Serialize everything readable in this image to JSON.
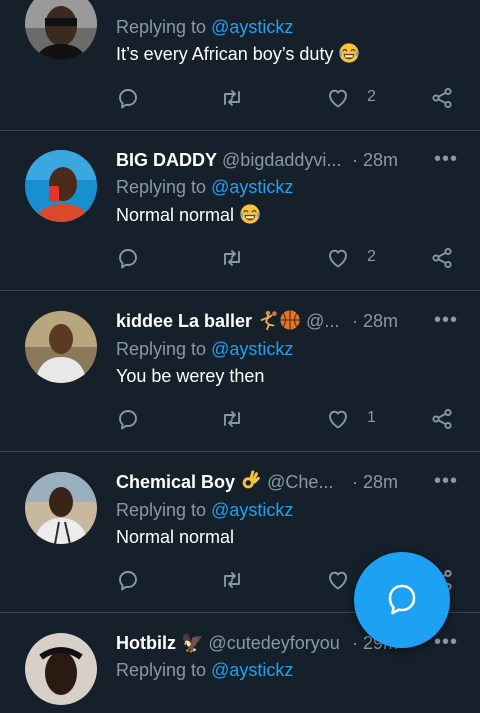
{
  "tweets": [
    {
      "name": "",
      "handle": "",
      "time": "",
      "replying_prefix": "Replying to ",
      "replying_to": "@aystickz",
      "text": "It’s every African boy’s duty",
      "text_emoji": "tears-of-joy-emoji",
      "likes": "2"
    },
    {
      "name": "BIG DADDY",
      "handle": "@bigdaddyvi...",
      "time": "· 28m",
      "replying_prefix": "Replying to ",
      "replying_to": "@aystickz",
      "text": "Normal normal",
      "text_emoji": "tears-of-joy-emoji",
      "likes": "2"
    },
    {
      "name": "kiddee La baller",
      "name_emojis": [
        "basketball-player-emoji",
        "basketball-emoji"
      ],
      "handle": "@...",
      "time": "· 28m",
      "replying_prefix": "Replying to ",
      "replying_to": "@aystickz",
      "text": "You be werey then",
      "likes": "1"
    },
    {
      "name": "Chemical Boy",
      "name_emojis": [
        "ok-hand-emoji"
      ],
      "handle": "@Che...",
      "time": "· 28m",
      "replying_prefix": "Replying to ",
      "replying_to": "@aystickz",
      "text": "Normal normal",
      "likes": ""
    },
    {
      "name": "Hotbilz 🦅",
      "handle": "@cutedeyforyou",
      "time": "· 29m",
      "replying_prefix": "Replying to ",
      "replying_to": "@aystickz",
      "text": "",
      "likes": ""
    }
  ],
  "more_glyph": "•••",
  "colors": {
    "background": "#15202b",
    "divider": "#38444d",
    "secondary_text": "#8899a6",
    "accent": "#1da1f2"
  },
  "fab": {
    "icon": "compose-reply-icon"
  }
}
